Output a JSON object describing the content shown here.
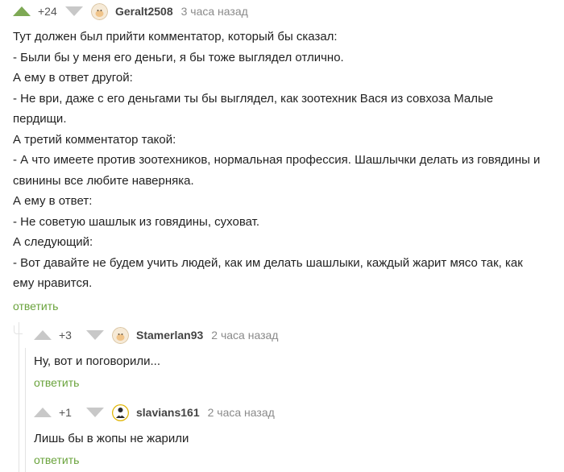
{
  "comments": [
    {
      "rating": "+24",
      "username": "Geralt2508",
      "time": "3 часа назад",
      "avatar_icon": "pikabu-default-avatar-icon",
      "body": [
        "Тут должен был прийти комментатор, который бы сказал:",
        "- Были бы у меня его деньги, я бы тоже выглядел отлично.",
        "А ему в ответ другой:",
        "- Не ври, даже с его деньгами ты бы выглядел, как зоотехник Вася из совхоза Малые пердищи.",
        "А третий комментатор такой:",
        "- А что имеете против зоотехников, нормальная профессия. Шашлычки делать из говядины и свинины все любите наверняка.",
        "А ему в ответ:",
        "- Не советую шашлык из говядины, суховат.",
        "А следующий:",
        "- Вот давайте не будем учить людей, как им делать шашлыки, каждый жарит мясо так, как ему нравится."
      ],
      "reply_label": "ответить"
    },
    {
      "rating": "+3",
      "username": "Stamerlan93",
      "time": "2 часа назад",
      "avatar_icon": "pikabu-default-avatar-icon",
      "body": [
        "Ну, вот и поговорили..."
      ],
      "reply_label": "ответить"
    },
    {
      "rating": "+1",
      "username": "slavians161",
      "time": "2 часа назад",
      "avatar_icon": "custom-user-avatar-icon",
      "body": [
        "Лишь бы в жопы не жарили"
      ],
      "reply_label": "ответить"
    }
  ],
  "colors": {
    "vote_up_active": "#7ea955",
    "vote_inactive": "#c8c8c8",
    "reply_link": "#6aa33c",
    "time": "#8a8a8a"
  }
}
